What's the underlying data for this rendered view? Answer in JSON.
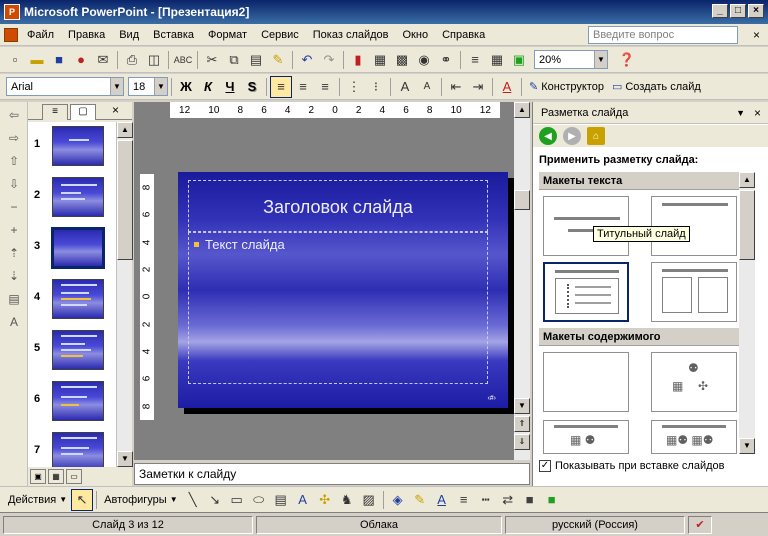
{
  "window": {
    "title": "Microsoft PowerPoint - [Презентация2]",
    "app_icon_label": "P"
  },
  "menu": [
    "Файл",
    "Правка",
    "Вид",
    "Вставка",
    "Формат",
    "Сервис",
    "Показ слайдов",
    "Окно",
    "Справка"
  ],
  "help_search_placeholder": "Введите вопрос",
  "standard_toolbar": {
    "zoom": "20%"
  },
  "format_toolbar": {
    "font": "Arial",
    "font_size": "18",
    "bold": "Ж",
    "italic": "К",
    "underline": "Ч",
    "shadow": "S",
    "designer_label": "Конструктор",
    "new_slide_label": "Создать слайд"
  },
  "thumbnails": {
    "tabs": [
      "outline",
      "slides"
    ],
    "selected": 3,
    "items": [
      {
        "num": "1"
      },
      {
        "num": "2"
      },
      {
        "num": "3"
      },
      {
        "num": "4"
      },
      {
        "num": "5"
      },
      {
        "num": "6"
      },
      {
        "num": "7"
      }
    ]
  },
  "ruler_top": [
    "12",
    "10",
    "8",
    "6",
    "4",
    "2",
    "0",
    "2",
    "4",
    "6",
    "8",
    "10",
    "12"
  ],
  "ruler_left": [
    "8",
    "6",
    "4",
    "2",
    "0",
    "2",
    "4",
    "6",
    "8"
  ],
  "slide": {
    "title_placeholder": "Заголовок слайда",
    "body_placeholder": "Текст слайда",
    "number": "‹#›"
  },
  "notes_placeholder": "Заметки к слайду",
  "task_pane": {
    "title": "Разметка слайда",
    "apply_label": "Применить разметку слайда:",
    "section_text": "Макеты текста",
    "section_content": "Макеты содержимого",
    "tooltip": "Титульный слайд",
    "show_on_insert_label": "Показывать при вставке слайдов",
    "show_on_insert_checked": true
  },
  "drawing_toolbar": {
    "actions_label": "Действия",
    "autoshapes_label": "Автофигуры"
  },
  "status": {
    "slide_info": "Слайд 3 из 12",
    "design": "Облака",
    "language": "русский (Россия)"
  }
}
